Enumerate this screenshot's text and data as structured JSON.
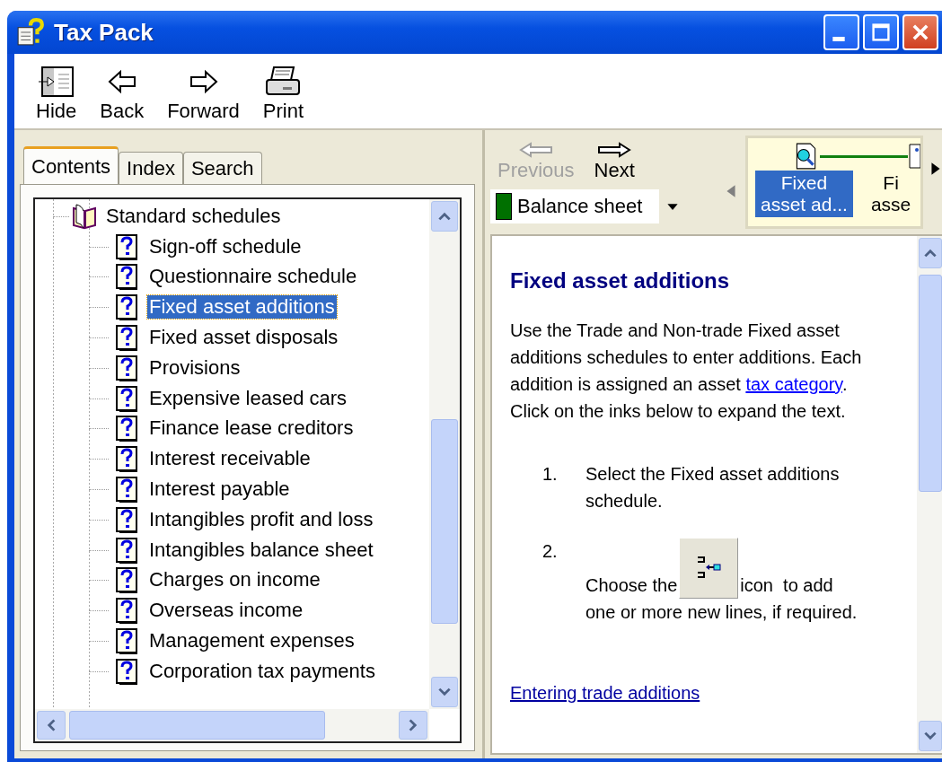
{
  "window": {
    "title": "Tax Pack"
  },
  "toolbar": [
    {
      "label": "Hide",
      "kind": "hide"
    },
    {
      "label": "Back",
      "kind": "back"
    },
    {
      "label": "Forward",
      "kind": "forward"
    },
    {
      "label": "Print",
      "kind": "print"
    }
  ],
  "tabs": [
    {
      "label": "Contents",
      "selected": true
    },
    {
      "label": "Index",
      "selected": false
    },
    {
      "label": "Search",
      "selected": false
    }
  ],
  "tree": [
    {
      "label": "Standard schedules",
      "kind": "book",
      "expanded": true,
      "selected": false,
      "children": [
        {
          "label": "Sign-off schedule",
          "kind": "topic",
          "selected": false
        },
        {
          "label": "Questionnaire schedule",
          "kind": "topic",
          "selected": false
        },
        {
          "label": "Fixed asset additions",
          "kind": "topic",
          "selected": true
        },
        {
          "label": "Fixed asset disposals",
          "kind": "topic",
          "selected": false
        },
        {
          "label": "Provisions",
          "kind": "topic",
          "selected": false
        },
        {
          "label": "Expensive leased cars",
          "kind": "topic",
          "selected": false
        },
        {
          "label": "Finance lease creditors",
          "kind": "topic",
          "selected": false
        },
        {
          "label": "Interest receivable",
          "kind": "topic",
          "selected": false
        },
        {
          "label": "Interest payable",
          "kind": "topic",
          "selected": false
        },
        {
          "label": "Intangibles profit and loss",
          "kind": "topic",
          "selected": false
        },
        {
          "label": "Intangibles balance sheet",
          "kind": "topic",
          "selected": false
        },
        {
          "label": "Charges on income",
          "kind": "topic",
          "selected": false
        },
        {
          "label": "Overseas income",
          "kind": "topic",
          "selected": false
        },
        {
          "label": "Management expenses",
          "kind": "topic",
          "selected": false
        },
        {
          "label": "Corporation tax payments",
          "kind": "topic",
          "selected": false
        }
      ]
    }
  ],
  "nav": [
    {
      "label": "Previous",
      "kind": "previous",
      "disabled": true
    },
    {
      "label": "Next",
      "kind": "next",
      "disabled": false
    }
  ],
  "section_dropdown": {
    "value": "Balance sheet",
    "color": "#007000"
  },
  "breadcrumbs": [
    {
      "lines": [
        "Fixed",
        "asset ad..."
      ],
      "selected": true
    },
    {
      "lines": [
        "Fi",
        "asse"
      ],
      "selected": false
    }
  ],
  "article": {
    "heading": "Fixed asset additions",
    "intro": {
      "before": "Use the Trade and Non-trade Fixed asset additions schedules to enter additions. Each addition is assigned an asset ",
      "link": "tax category",
      "after": ". Click on the inks below to expand the text."
    },
    "steps": [
      {
        "number": "1.",
        "before": "Select the Fixed asset additions schedule."
      },
      {
        "number": "2.",
        "before": "Choose the",
        "after": "icon  to add",
        "continuation": "one or more new lines, if required."
      }
    ],
    "links": [
      "Entering trade additions"
    ]
  }
}
